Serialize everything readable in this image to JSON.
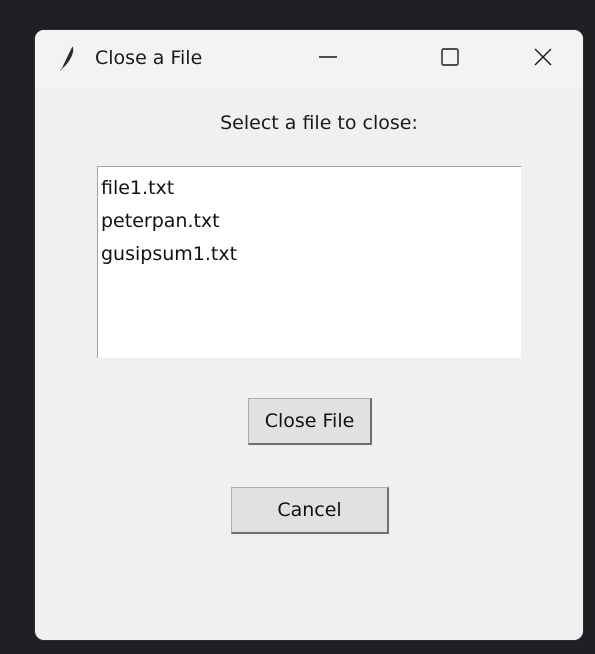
{
  "window": {
    "title": "Close a File",
    "icon": "feather-icon"
  },
  "title_controls": {
    "minimize_icon": "minimize-icon",
    "maximize_icon": "maximize-icon",
    "close_icon": "close-icon"
  },
  "prompt": "Select a file to close:",
  "files": [
    "file1.txt",
    "peterpan.txt",
    "gusipsum1.txt"
  ],
  "buttons": {
    "close_file": "Close File",
    "cancel": "Cancel"
  }
}
